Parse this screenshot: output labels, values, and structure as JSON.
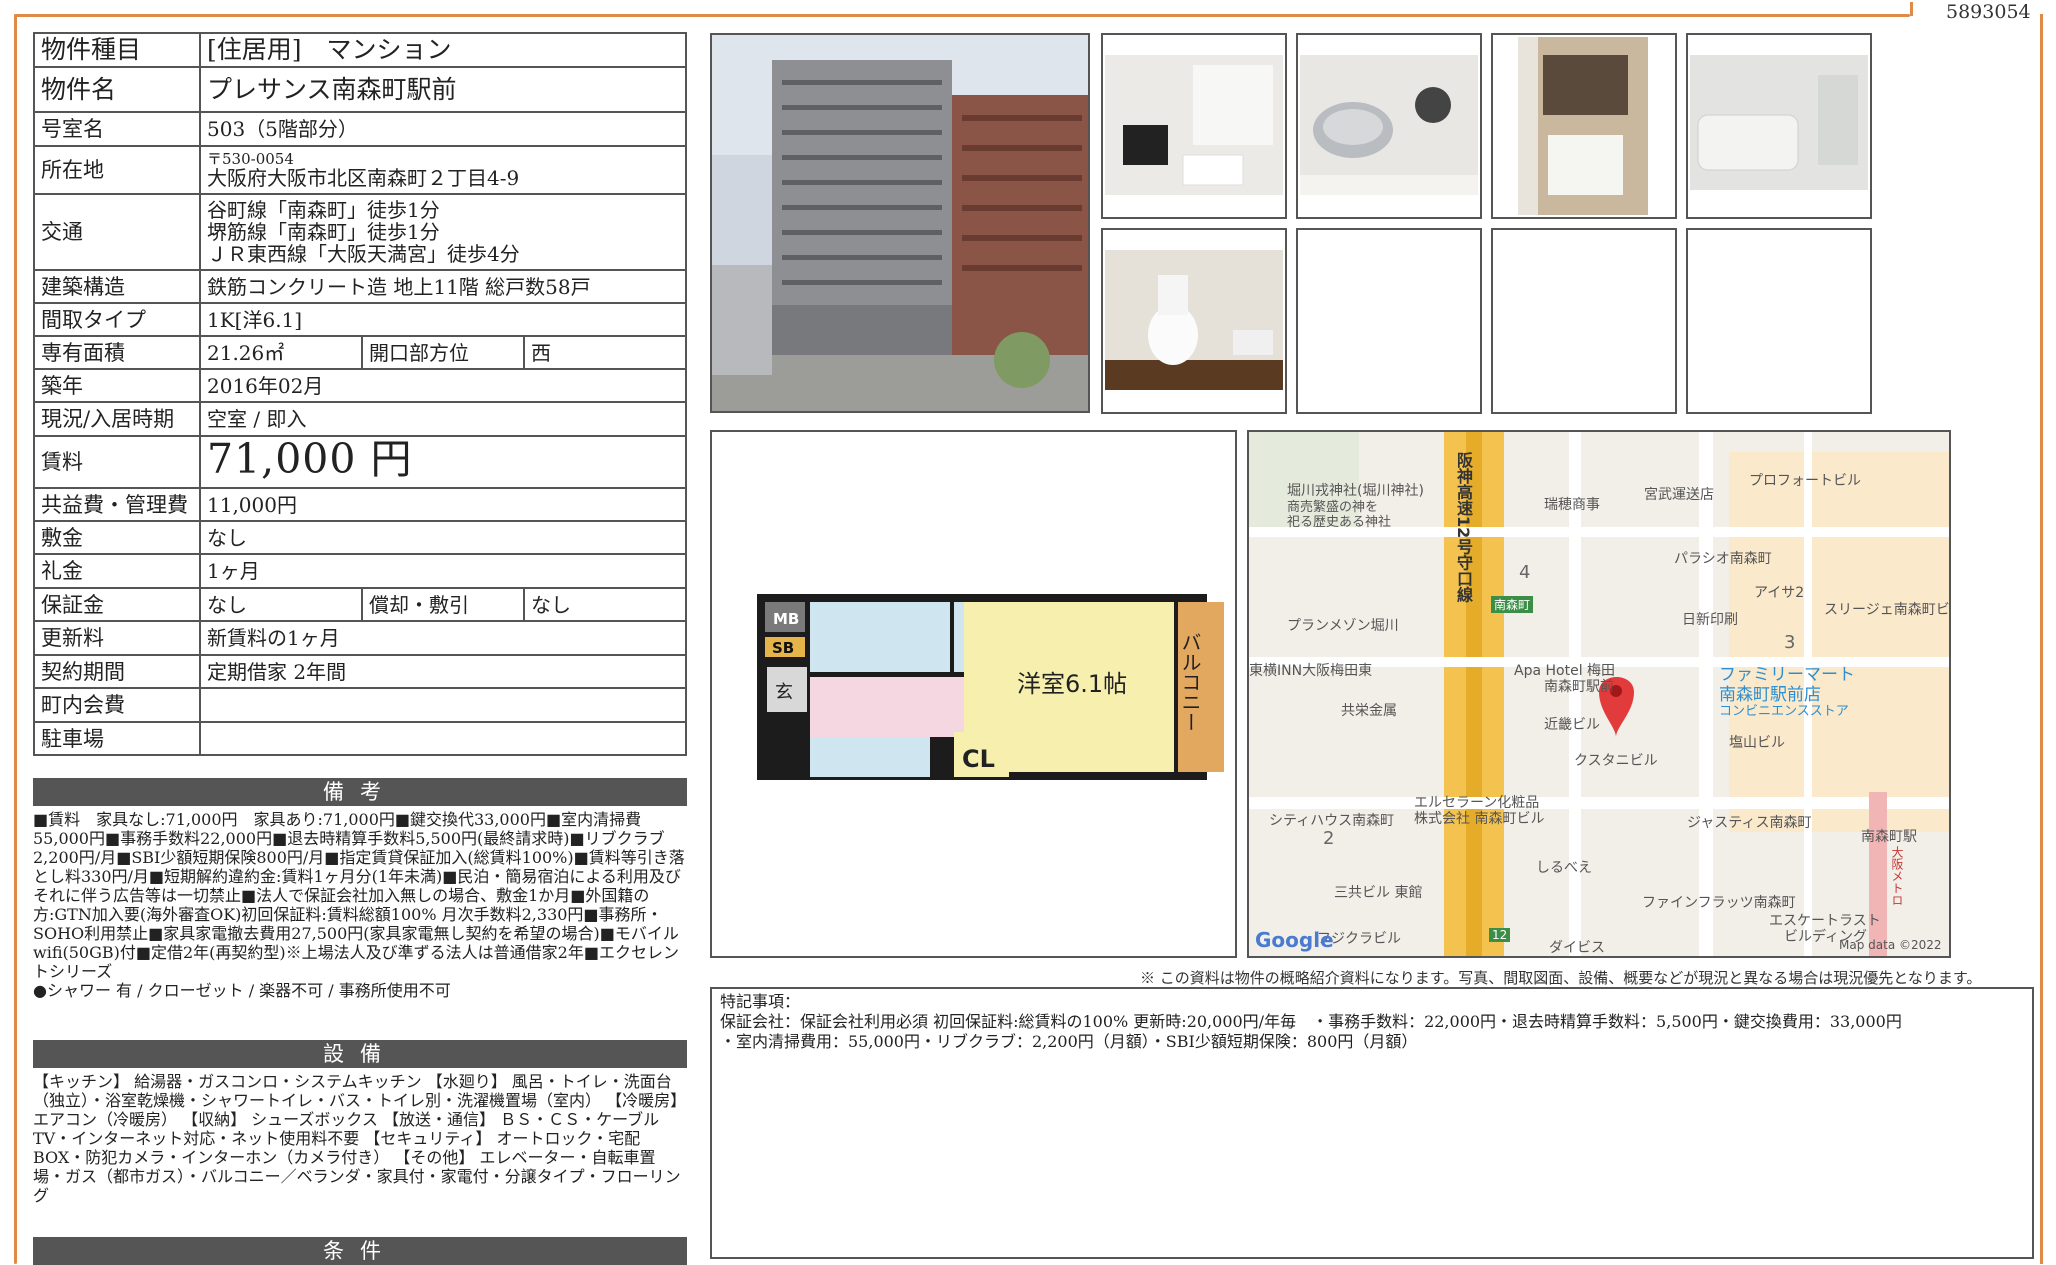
{
  "document_number": "5893054",
  "property": {
    "type_label": "物件種目",
    "type_value": "[住居用]　マンション",
    "name_label": "物件名",
    "name_value": "プレサンス南森町駅前",
    "room_label": "号室名",
    "room_value": "503（5階部分）",
    "address_label": "所在地",
    "postal": "〒530-0054",
    "address_value": "大阪府大阪市北区南森町２丁目4-9",
    "access_label": "交通",
    "access_lines": [
      "谷町線「南森町」徒歩1分",
      "堺筋線「南森町」徒歩1分",
      "ＪＲ東西線「大阪天満宮」徒歩4分"
    ],
    "structure_label": "建築構造",
    "structure_value": "鉄筋コンクリート造 地上11階 総戸数58戸",
    "layout_label": "間取タイプ",
    "layout_value": "1K[洋6.1]",
    "area_label": "専有面積",
    "area_value": "21.26㎡",
    "direction_label": "開口部方位",
    "direction_value": "西",
    "built_label": "築年",
    "built_value": "2016年02月",
    "status_label": "現況/入居時期",
    "status_value": "空室 / 即入",
    "rent_label": "賃料",
    "rent_value": "71,000",
    "rent_unit": "円",
    "fee_label": "共益費・管理費",
    "fee_value": "11,000円",
    "deposit_label": "敷金",
    "deposit_value": "なし",
    "key_money_label": "礼金",
    "key_money_value": "1ヶ月",
    "guarantee_label": "保証金",
    "guarantee_value": "なし",
    "amortize_label": "償却・敷引",
    "amortize_value": "なし",
    "renewal_label": "更新料",
    "renewal_value": "新賃料の1ヶ月",
    "contract_label": "契約期間",
    "contract_value": "定期借家 2年間",
    "community_label": "町内会費",
    "community_value": "",
    "parking_label": "駐車場",
    "parking_value": ""
  },
  "remarks": {
    "heading": "備考",
    "text": "■賃料　家具なし:71,000円　家具あり:71,000円■鍵交換代33,000円■室内清掃費55,000円■事務手数料22,000円■退去時精算手数料5,500円(最終請求時)■リブクラブ2,200円/月■SBI少額短期保険800円/月■指定賃貸保証加入(総賃料100%)■賃料等引き落とし料330円/月■短期解約違約金:賃料1ヶ月分(1年未満)■民泊・簡易宿泊による利用及びそれに伴う広告等は一切禁止■法人で保証会社加入無しの場合、敷金1か月■外国籍の方:GTN加入要(海外審査OK)初回保証料:賃料総額100% 月次手数料2,330円■事務所・SOHO利用禁止■家具家電撤去費用27,500円(家具家電無し契約を希望の場合)■モバイルwifi(50GB)付■定借2年(再契約型)※上場法人及び準ずる法人は普通借家2年■エクセレントシリーズ",
    "line2": "●シャワー 有 / クローゼット / 楽器不可 / 事務所使用不可"
  },
  "equipment": {
    "heading": "設備",
    "text": "【キッチン】 給湯器・ガスコンロ・システムキッチン 【水廻り】 風呂・トイレ・洗面台（独立）・浴室乾燥機・シャワートイレ・バス・トイレ別・洗濯機置場（室内） 【冷暖房】 エアコン（冷暖房） 【収納】 シューズボックス 【放送・通信】 ＢＳ・ＣＳ・ケーブルTV・インターネット対応・ネット使用料不要 【セキュリティ】 オートロック・宅配BOX・防犯カメラ・インターホン（カメラ付き） 【その他】 エレベーター・自転車置場・ガス（都市ガス）・バルコニー／ベランダ・家具付・家電付・分譲タイプ・フローリング"
  },
  "conditions_heading": "条件",
  "floorplan": {
    "room_label": "洋室6.1帖",
    "balcony_label": "バルコニー",
    "mb": "MB",
    "sb": "SB",
    "entrance": "玄",
    "closet": "CL"
  },
  "map": {
    "labels": [
      "堀川戎神社(堀川神社)",
      "商売繁盛の神を",
      "祀る歴史ある神社",
      "瑞穂商事",
      "宮武運送店",
      "プロフォートビル",
      "パラシオ南森町",
      "アイサ2",
      "日新印刷",
      "スリージェ南森町ビ",
      "プランメゾン堀川",
      "東横INN大阪梅田東",
      "Apa Hotel 梅田",
      "南森町駅前",
      "ファミリーマート",
      "南森町駅前店",
      "コンビニエンスストア",
      "共栄金属",
      "近畿ビル",
      "クスタニビル",
      "塩山ビル",
      "エルセラーン化粧品",
      "株式会社 南森町ビル",
      "シティハウス南森町",
      "ジャスティス南森町",
      "南森町駅",
      "しるべえ",
      "三共ビル 東館",
      "ファインフラッツ南森町",
      "エスケートラスト",
      "ビルディング",
      "フジクラビル",
      "ダイビス",
      "阪神高速12号守口線",
      "南森町",
      "大阪メトロ",
      "Google",
      "Map data ©2022"
    ],
    "numbers": [
      "4",
      "3",
      "2",
      "12"
    ]
  },
  "disclaimer": "※ この資料は物件の概略紹介資料になります。写真、間取図面、設備、概要などが現況と異なる場合は現況優先となります。",
  "special_notes": {
    "title": "特記事項：",
    "line1": "保証会社：保証会社利用必須 初回保証料:総賃料の100% 更新時:20,000円/年毎　・事務手数料：22,000円・退去時精算手数料：5,500円・鍵交換費用：33,000円",
    "line2": "・室内清掃費用：55,000円・リブクラブ：2,200円（月額）・SBI少額短期保険：800円（月額）"
  }
}
